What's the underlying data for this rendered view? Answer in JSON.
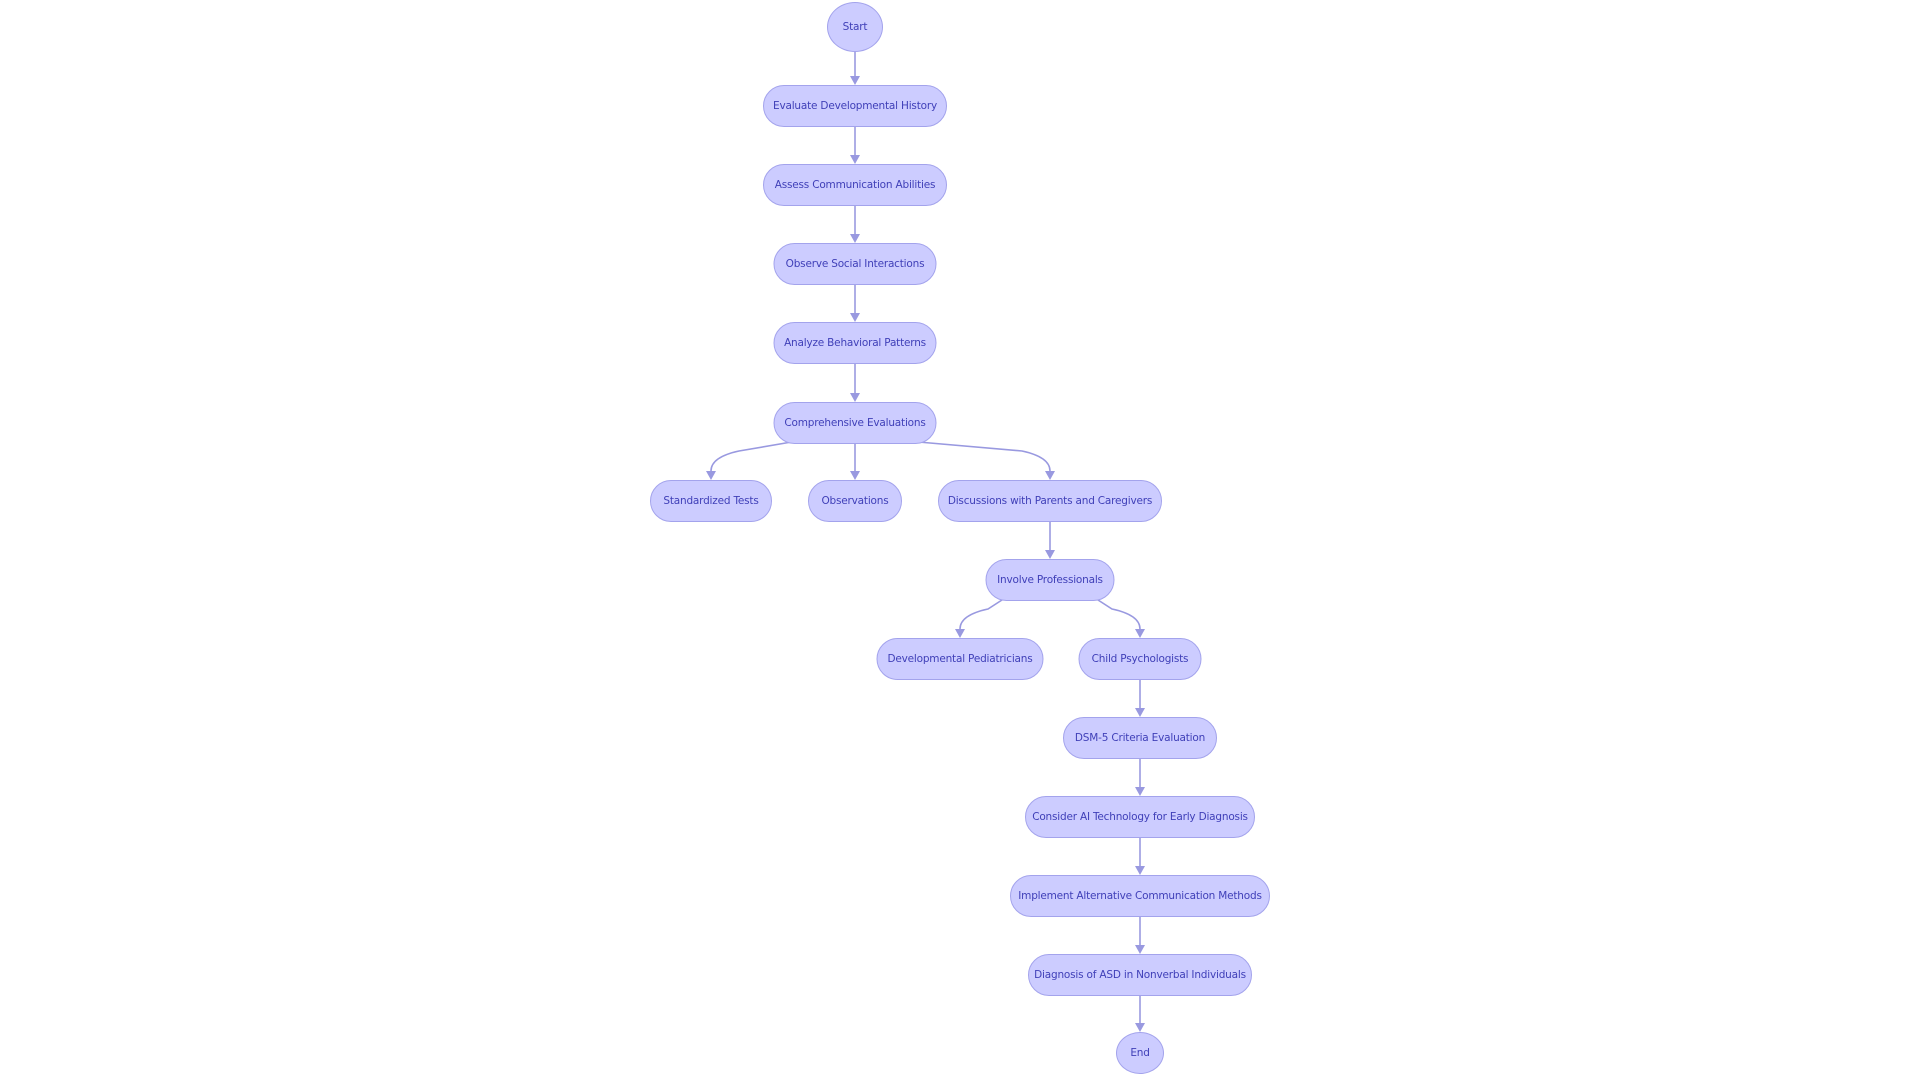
{
  "diagram": {
    "type": "flowchart",
    "colors": {
      "node_fill": "#ccccff",
      "node_border": "#a3a3ec",
      "node_text": "#3f3fb8",
      "edge": "#9999e0"
    },
    "nodes": [
      {
        "id": "start",
        "label": "Start",
        "shape": "circle"
      },
      {
        "id": "eval_history",
        "label": "Evaluate Developmental History",
        "shape": "stadium"
      },
      {
        "id": "assess_comm",
        "label": "Assess Communication Abilities",
        "shape": "stadium"
      },
      {
        "id": "observe_social",
        "label": "Observe Social Interactions",
        "shape": "stadium"
      },
      {
        "id": "analyze_behavior",
        "label": "Analyze Behavioral Patterns",
        "shape": "stadium"
      },
      {
        "id": "comprehensive",
        "label": "Comprehensive Evaluations",
        "shape": "stadium"
      },
      {
        "id": "standardized",
        "label": "Standardized Tests",
        "shape": "stadium"
      },
      {
        "id": "observations",
        "label": "Observations",
        "shape": "stadium"
      },
      {
        "id": "discussions",
        "label": "Discussions with Parents and Caregivers",
        "shape": "stadium"
      },
      {
        "id": "involve",
        "label": "Involve Professionals",
        "shape": "stadium"
      },
      {
        "id": "dev_pediatricians",
        "label": "Developmental Pediatricians",
        "shape": "stadium"
      },
      {
        "id": "child_psych",
        "label": "Child Psychologists",
        "shape": "stadium"
      },
      {
        "id": "dsm5",
        "label": "DSM-5 Criteria Evaluation",
        "shape": "stadium"
      },
      {
        "id": "ai_tech",
        "label": "Consider AI Technology for Early Diagnosis",
        "shape": "stadium"
      },
      {
        "id": "alt_comm",
        "label": "Implement Alternative Communication Methods",
        "shape": "stadium"
      },
      {
        "id": "diagnosis",
        "label": "Diagnosis of ASD in Nonverbal Individuals",
        "shape": "stadium"
      },
      {
        "id": "end",
        "label": "End",
        "shape": "circle"
      }
    ],
    "edges": [
      {
        "from": "start",
        "to": "eval_history"
      },
      {
        "from": "eval_history",
        "to": "assess_comm"
      },
      {
        "from": "assess_comm",
        "to": "observe_social"
      },
      {
        "from": "observe_social",
        "to": "analyze_behavior"
      },
      {
        "from": "analyze_behavior",
        "to": "comprehensive"
      },
      {
        "from": "comprehensive",
        "to": "standardized"
      },
      {
        "from": "comprehensive",
        "to": "observations"
      },
      {
        "from": "comprehensive",
        "to": "discussions"
      },
      {
        "from": "discussions",
        "to": "involve"
      },
      {
        "from": "involve",
        "to": "dev_pediatricians"
      },
      {
        "from": "involve",
        "to": "child_psych"
      },
      {
        "from": "child_psych",
        "to": "dsm5"
      },
      {
        "from": "dsm5",
        "to": "ai_tech"
      },
      {
        "from": "ai_tech",
        "to": "alt_comm"
      },
      {
        "from": "alt_comm",
        "to": "diagnosis"
      },
      {
        "from": "diagnosis",
        "to": "end"
      }
    ]
  }
}
